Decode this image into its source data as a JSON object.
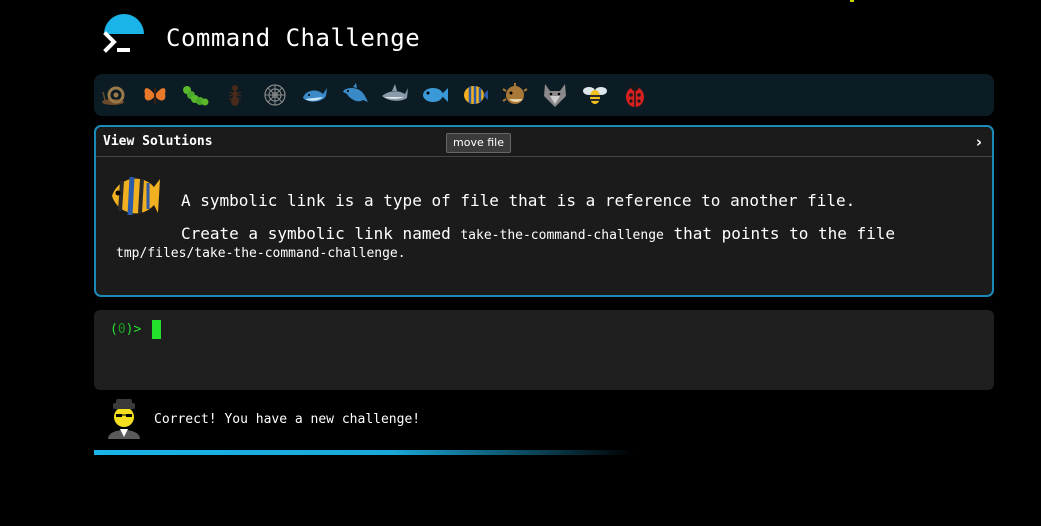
{
  "header": {
    "title": "Command Challenge",
    "logo_icon": "terminal-prompt-icon"
  },
  "icon_bar": {
    "items": [
      {
        "name": "snail-icon",
        "color": "#8a6a4a"
      },
      {
        "name": "butterfly-icon",
        "color": "#e8782a"
      },
      {
        "name": "caterpillar-icon",
        "color": "#5ab82a"
      },
      {
        "name": "ant-icon",
        "color": "#3a2a1a"
      },
      {
        "name": "spider-web-icon",
        "color": "#777777"
      },
      {
        "name": "whale-icon",
        "color": "#3a8ac8"
      },
      {
        "name": "dolphin-icon",
        "color": "#3a8ac8"
      },
      {
        "name": "shark-icon",
        "color": "#8a9aa8"
      },
      {
        "name": "fish-icon",
        "color": "#3a9ad8"
      },
      {
        "name": "tropical-fish-icon",
        "color": "#f0b020"
      },
      {
        "name": "blowfish-icon",
        "color": "#a87838"
      },
      {
        "name": "wolf-icon",
        "color": "#8a8a8a"
      },
      {
        "name": "bee-icon",
        "color": "#f0c020"
      },
      {
        "name": "ladybug-icon",
        "color": "#d82020"
      }
    ]
  },
  "challenge": {
    "view_solutions_label": "View Solutions",
    "chevron": "›",
    "move_button_label": "move file",
    "line1": "A symbolic link is a type of file that is a reference to another file.",
    "line2_prefix": "Create a symbolic link named ",
    "line2_code": "take-the-command-challenge",
    "line2_suffix": " that points to the file",
    "line3": "tmp/files/take-the-command-challenge."
  },
  "terminal": {
    "prompt_open": "(",
    "prompt_zero": "0",
    "prompt_close": ")>"
  },
  "status": {
    "message": "Correct! You have a new challenge!",
    "progress_fraction": 1.0
  },
  "colors": {
    "accent": "#1ab4e8",
    "terminal_green": "#22e02c",
    "panel_border": "#1c8ab8"
  }
}
